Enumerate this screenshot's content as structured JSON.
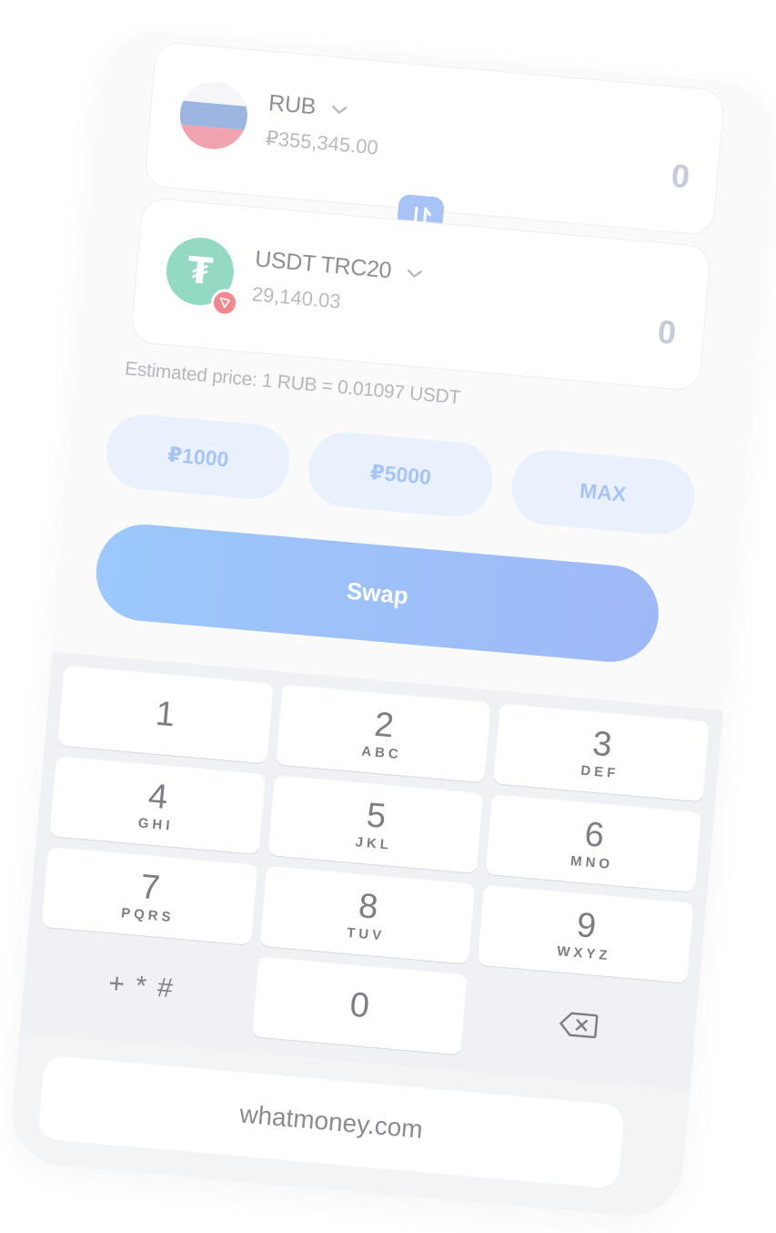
{
  "from": {
    "currency": "RUB",
    "balance": "₽355,345.00",
    "amount": "0",
    "icon": "russia-flag-icon"
  },
  "to": {
    "currency": "USDT TRC20",
    "balance": "29,140.03",
    "amount": "0",
    "icon": "tether-icon",
    "network_icon": "tron-icon"
  },
  "estimate": "Estimated price: 1 RUB = 0.01097 USDT",
  "presets": [
    "₽1000",
    "₽5000",
    "MAX"
  ],
  "swap_label": "Swap",
  "keypad": {
    "keys": [
      {
        "digit": "1",
        "letters": ""
      },
      {
        "digit": "2",
        "letters": "ABC"
      },
      {
        "digit": "3",
        "letters": "DEF"
      },
      {
        "digit": "4",
        "letters": "GHI"
      },
      {
        "digit": "5",
        "letters": "JKL"
      },
      {
        "digit": "6",
        "letters": "MNO"
      },
      {
        "digit": "7",
        "letters": "PQRS"
      },
      {
        "digit": "8",
        "letters": "TUV"
      },
      {
        "digit": "9",
        "letters": "WXYZ"
      }
    ],
    "symbols": "+ * #",
    "zero": "0",
    "delete_icon": "backspace-icon"
  },
  "url": "whatmoney.com",
  "colors": {
    "accent": "#9fb9f7",
    "preset_bg": "#e9f1fd",
    "preset_text": "#a7c4f3",
    "tether": "#93d9c4",
    "tron": "#f3868e"
  }
}
